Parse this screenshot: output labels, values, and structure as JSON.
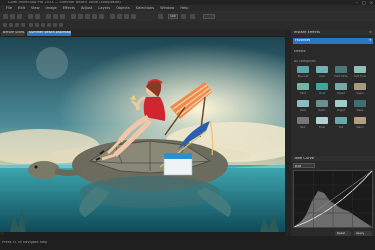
{
  "app": {
    "title": "Corel PaintShop Pro 2023 — Summer Beach Turtle (composite)"
  },
  "menubar": {
    "items": [
      "File",
      "Edit",
      "View",
      "Image",
      "Effects",
      "Adjust",
      "Layers",
      "Objects",
      "Selections",
      "Window",
      "Help"
    ]
  },
  "toolbar": {
    "zoom_value": "100"
  },
  "tabs": {
    "doc1": "Before Sides.psd",
    "doc2": "Summer beach.pspimage"
  },
  "right_panel": {
    "panel1_title": "Instant Effects",
    "dropdown": "Favorites",
    "section1": "Effects",
    "section2": "All categories",
    "effect_tiles": [
      {
        "label": "Blue Lift",
        "color": "#5aa6a8"
      },
      {
        "label": "Cool",
        "color": "#6fb3b4"
      },
      {
        "label": "Dark Fade",
        "color": "#4a7b7a"
      },
      {
        "label": "Soft Tone",
        "color": "#8fc0b7"
      },
      {
        "label": "Mint",
        "color": "#74b5a5"
      },
      {
        "label": "Vivid",
        "color": "#3ea79b"
      },
      {
        "label": "Faded",
        "color": "#7aa7a9"
      },
      {
        "label": "Sepia",
        "color": "#a59b7f"
      },
      {
        "label": "Glow",
        "color": "#8fbcc0"
      },
      {
        "label": "Retro",
        "color": "#6b8f8d"
      },
      {
        "label": "Bright",
        "color": "#9fcfcb"
      },
      {
        "label": "Deep",
        "color": "#3e6f72"
      },
      {
        "label": "Noir",
        "color": "#777777"
      },
      {
        "label": "Frost",
        "color": "#b0d2d4"
      },
      {
        "label": "Tint",
        "color": "#6ba8ab"
      },
      {
        "label": "Warm",
        "color": "#b49f83"
      }
    ],
    "panel2_title": "Tone Curve",
    "channel": "RGB",
    "apply": "Apply",
    "reset": "Reset"
  },
  "status": {
    "text": "Press F1 to navigate help"
  },
  "accent": "#2a78c4"
}
